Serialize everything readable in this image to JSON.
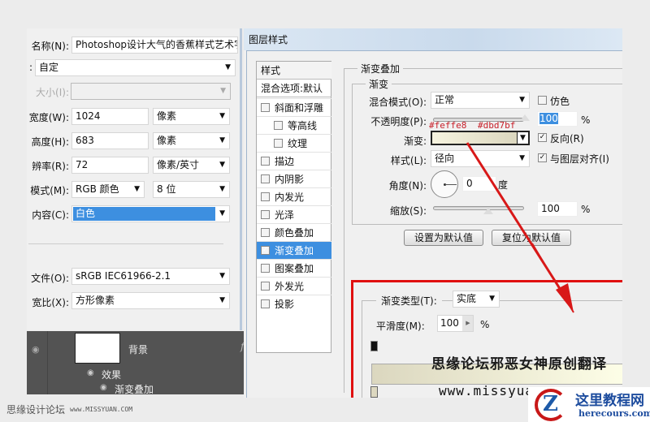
{
  "new_doc": {
    "name_label": "名称(N):",
    "name_value": "Photoshop设计大气的香蕉样式艺术字",
    "preset_label": ":",
    "preset_value": "自定",
    "size_label": "大小(I):",
    "width_label": "宽度(W):",
    "width_value": "1024",
    "width_unit": "像素",
    "height_label": "高度(H):",
    "height_value": "683",
    "height_unit": "像素",
    "res_label": "辨率(R):",
    "res_value": "72",
    "res_unit": "像素/英寸",
    "mode_label": "模式(M):",
    "mode_value": "RGB 颜色",
    "depth_value": "8 位",
    "content_label": "内容(C):",
    "content_value": "白色",
    "profile_label": "文件(O):",
    "profile_value": "sRGB IEC61966-2.1",
    "aspect_label": "宽比(X):",
    "aspect_value": "方形像素"
  },
  "layers": {
    "layer_name": "背景",
    "fx": "fx",
    "effects": "效果",
    "effect_item": "渐变叠加"
  },
  "dialog": {
    "title": "图层样式",
    "styles_header": "样式",
    "blend_default": "混合选项:默认",
    "styles": [
      {
        "label": "斜面和浮雕",
        "checked": false,
        "indent": false
      },
      {
        "label": "等高线",
        "checked": false,
        "indent": true
      },
      {
        "label": "纹理",
        "checked": false,
        "indent": true
      },
      {
        "label": "描边",
        "checked": false,
        "indent": false
      },
      {
        "label": "内阴影",
        "checked": false,
        "indent": false
      },
      {
        "label": "内发光",
        "checked": false,
        "indent": false
      },
      {
        "label": "光泽",
        "checked": false,
        "indent": false
      },
      {
        "label": "颜色叠加",
        "checked": false,
        "indent": false
      },
      {
        "label": "渐变叠加",
        "checked": true,
        "indent": false,
        "selected": true
      },
      {
        "label": "图案叠加",
        "checked": false,
        "indent": false
      },
      {
        "label": "外发光",
        "checked": false,
        "indent": false
      },
      {
        "label": "投影",
        "checked": false,
        "indent": false
      }
    ],
    "section_title": "渐变叠加",
    "group_title": "渐变",
    "blend_mode_label": "混合模式(O):",
    "blend_mode_value": "正常",
    "dither_label": "仿色",
    "opacity_label": "不透明度(P):",
    "opacity_value": "100",
    "pct": "%",
    "gradient_label": "渐变:",
    "reverse_label": "反向(R)",
    "style_label": "样式(L):",
    "style_value": "径向",
    "align_label": "与图层对齐(I)",
    "angle_label": "角度(N):",
    "angle_value": "0",
    "angle_unit": "度",
    "scale_label": "缩放(S):",
    "scale_value": "100",
    "set_default": "设置为默认值",
    "reset_default": "复位为默认值",
    "annotation_color1": "#feffe8",
    "annotation_color2": "#dbd7bf"
  },
  "gradient_editor": {
    "type_label": "渐变类型(T):",
    "type_value": "实底",
    "smooth_label": "平滑度(M):",
    "smooth_value": "100",
    "pct": "%",
    "watermark1": "思缘论坛邪恶女神原创翻译",
    "watermark2": "www.missyuan.com"
  },
  "footer": {
    "left": "思缘设计论坛",
    "left_url": "www.MISSYUAN.COM",
    "logo_title": "这里教程网",
    "logo_url": "herecours.com"
  }
}
